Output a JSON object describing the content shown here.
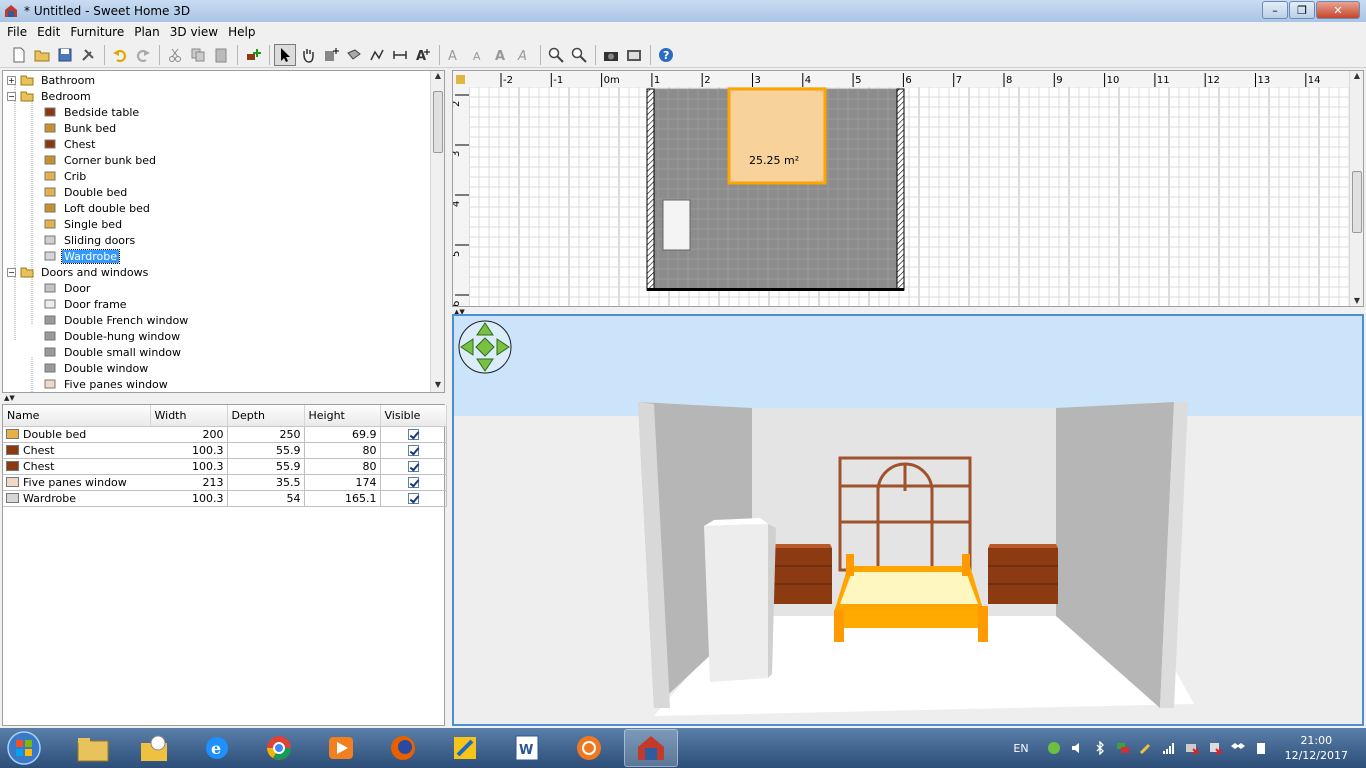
{
  "window": {
    "title": "* Untitled - Sweet Home 3D"
  },
  "menu": [
    "File",
    "Edit",
    "Furniture",
    "Plan",
    "3D view",
    "Help"
  ],
  "catalog": {
    "rows": [
      {
        "label": "Bathroom",
        "type": "category",
        "expanded": false,
        "icon": "folder-icon"
      },
      {
        "label": "Bedroom",
        "type": "category",
        "expanded": true,
        "icon": "folder-icon"
      },
      {
        "label": "Bedside table",
        "type": "item",
        "icon": "bedside-table-icon"
      },
      {
        "label": "Bunk bed",
        "type": "item",
        "icon": "bunk-bed-icon"
      },
      {
        "label": "Chest",
        "type": "item",
        "icon": "chest-icon"
      },
      {
        "label": "Corner bunk bed",
        "type": "item",
        "icon": "corner-bunk-bed-icon"
      },
      {
        "label": "Crib",
        "type": "item",
        "icon": "crib-icon"
      },
      {
        "label": "Double bed",
        "type": "item",
        "icon": "double-bed-icon"
      },
      {
        "label": "Loft double bed",
        "type": "item",
        "icon": "loft-bed-icon"
      },
      {
        "label": "Single bed",
        "type": "item",
        "icon": "single-bed-icon"
      },
      {
        "label": "Sliding doors",
        "type": "item",
        "icon": "sliding-doors-icon"
      },
      {
        "label": "Wardrobe",
        "type": "item",
        "selected": true,
        "icon": "wardrobe-icon"
      },
      {
        "label": "Doors and windows",
        "type": "category",
        "expanded": true,
        "icon": "folder-icon"
      },
      {
        "label": "Door",
        "type": "item",
        "icon": "door-icon"
      },
      {
        "label": "Door frame",
        "type": "item",
        "icon": "door-frame-icon"
      },
      {
        "label": "Double French window",
        "type": "item",
        "icon": "french-window-icon"
      },
      {
        "label": "Double-hung window",
        "type": "item",
        "icon": "window-icon"
      },
      {
        "label": "Double small window",
        "type": "item",
        "icon": "window-icon"
      },
      {
        "label": "Double window",
        "type": "item",
        "icon": "window-icon"
      },
      {
        "label": "Five panes window",
        "type": "item",
        "icon": "five-panes-window-icon"
      }
    ]
  },
  "furniture_table": {
    "columns": [
      "Name",
      "Width",
      "Depth",
      "Height",
      "Visible"
    ],
    "rows": [
      {
        "name": "Double bed",
        "width": "200",
        "depth": "250",
        "height": "69.9",
        "visible": true,
        "icon": "double-bed-icon"
      },
      {
        "name": "Chest",
        "width": "100.3",
        "depth": "55.9",
        "height": "80",
        "visible": true,
        "icon": "chest-icon"
      },
      {
        "name": "Chest",
        "width": "100.3",
        "depth": "55.9",
        "height": "80",
        "visible": true,
        "icon": "chest-icon"
      },
      {
        "name": "Five panes window",
        "width": "213",
        "depth": "35.5",
        "height": "174",
        "visible": true,
        "icon": "five-panes-window-icon"
      },
      {
        "name": "Wardrobe",
        "width": "100.3",
        "depth": "54",
        "height": "165.1",
        "visible": true,
        "icon": "wardrobe-icon"
      }
    ]
  },
  "plan": {
    "ruler_x": [
      "-2",
      "-1",
      "0m",
      "1",
      "2",
      "3",
      "4",
      "5",
      "6",
      "7",
      "8",
      "9",
      "10",
      "11",
      "12",
      "13",
      "14"
    ],
    "ruler_y": [
      "2",
      "3",
      "4",
      "5",
      "6"
    ],
    "room_area": "25.25 m²"
  },
  "taskbar": {
    "language": "EN",
    "time": "21:00",
    "date": "12/12/2017"
  },
  "colors": {
    "selection": "#3399ff",
    "bed_frame": "#ffaa00",
    "chest": "#8b3a12",
    "wall": "#b0b0b0",
    "sky": "#cce4fa"
  }
}
